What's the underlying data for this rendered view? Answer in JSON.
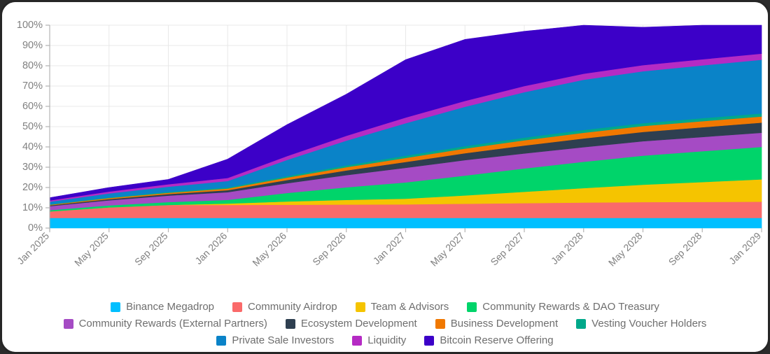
{
  "chart_data": {
    "type": "area",
    "stacked": true,
    "stack_mode": "percent",
    "title": "",
    "xlabel": "",
    "ylabel": "",
    "ylim": [
      0,
      100
    ],
    "ytick_labels": [
      "0%",
      "10%",
      "20%",
      "30%",
      "40%",
      "50%",
      "60%",
      "70%",
      "80%",
      "90%",
      "100%"
    ],
    "ytick_values": [
      0,
      10,
      20,
      30,
      40,
      50,
      60,
      70,
      80,
      90,
      100
    ],
    "grid": true,
    "legend_position": "bottom",
    "x": [
      "Jan 2025",
      "May 2025",
      "Sep 2025",
      "Jan 2026",
      "May 2026",
      "Sep 2026",
      "Jan 2027",
      "May 2027",
      "Sep 2027",
      "Jan 2028",
      "May 2028",
      "Sep 2028",
      "Jan 2029"
    ],
    "xtick_labels": [
      "Jan 2025",
      "May 2025",
      "Sep 2025",
      "Jan 2026",
      "May 2026",
      "Sep 2026",
      "Jan 2027",
      "May 2027",
      "Sep 2027",
      "Jan 2028",
      "May 2028",
      "Sep 2028",
      "Jan 2029"
    ],
    "series": [
      {
        "name": "Binance Megadrop",
        "color": "#00bfff",
        "values": [
          5.0,
          5.0,
          5.0,
          5.0,
          5.0,
          5.0,
          5.0,
          5.0,
          5.0,
          5.0,
          5.0,
          5.0,
          5.0
        ]
      },
      {
        "name": "Community Airdrop",
        "color": "#fa6a6a",
        "values": [
          3.2,
          5.2,
          6.4,
          6.4,
          6.5,
          6.6,
          6.7,
          7.0,
          7.3,
          7.6,
          7.8,
          7.9,
          8.0
        ]
      },
      {
        "name": "Team & Advisors",
        "color": "#f5c400",
        "values": [
          0.0,
          0.0,
          0.0,
          0.7,
          1.6,
          2.3,
          2.8,
          4.1,
          5.6,
          7.1,
          8.6,
          9.8,
          11.0
        ]
      },
      {
        "name": "Community Rewards & DAO Treasury",
        "color": "#00d46a",
        "values": [
          0.6,
          1.0,
          1.4,
          1.8,
          4.2,
          6.2,
          8.0,
          9.8,
          11.5,
          13.0,
          14.3,
          15.2,
          16.0
        ]
      },
      {
        "name": "Community Rewards (External Partners)",
        "color": "#a54bc4",
        "values": [
          2.0,
          2.5,
          3.2,
          3.8,
          4.8,
          6.0,
          7.2,
          7.6,
          7.4,
          7.2,
          7.1,
          7.0,
          7.0
        ]
      },
      {
        "name": "Ecosystem Development",
        "color": "#2e3f50",
        "values": [
          0.4,
          0.6,
          0.8,
          1.0,
          1.6,
          2.3,
          2.9,
          3.4,
          3.9,
          4.3,
          4.6,
          4.8,
          5.0
        ]
      },
      {
        "name": "Business Development",
        "color": "#f07800",
        "values": [
          0.3,
          0.5,
          0.6,
          0.8,
          1.2,
          1.6,
          2.0,
          2.3,
          2.6,
          2.8,
          2.9,
          3.0,
          3.0
        ]
      },
      {
        "name": "Vesting Voucher Holders",
        "color": "#00a88a",
        "values": [
          0.2,
          0.3,
          0.4,
          0.5,
          0.7,
          0.9,
          1.1,
          1.2,
          1.3,
          1.4,
          1.4,
          1.5,
          1.5
        ]
      },
      {
        "name": "Private Sale Investors",
        "color": "#0a83c8",
        "values": [
          1.3,
          2.0,
          2.6,
          3.2,
          8.0,
          12.2,
          16.0,
          19.4,
          22.4,
          24.7,
          25.6,
          26.0,
          26.5
        ]
      },
      {
        "name": "Liquidity",
        "color": "#b52bc4",
        "values": [
          0.6,
          0.9,
          1.2,
          1.5,
          1.9,
          2.4,
          2.8,
          2.9,
          3.0,
          3.0,
          3.0,
          3.0,
          3.0
        ]
      },
      {
        "name": "Bitcoin Reserve Offering",
        "color": "#3c00c8",
        "values": [
          1.4,
          2.0,
          2.4,
          9.3,
          15.5,
          20.5,
          28.5,
          30.3,
          27.0,
          23.9,
          18.7,
          16.8,
          14.0
        ]
      }
    ]
  },
  "legend": {
    "rows": [
      [
        {
          "label": "Binance Megadrop",
          "color": "#00bfff"
        },
        {
          "label": "Community Airdrop",
          "color": "#fa6a6a"
        },
        {
          "label": "Team & Advisors",
          "color": "#f5c400"
        },
        {
          "label": "Community Rewards & DAO Treasury",
          "color": "#00d46a"
        }
      ],
      [
        {
          "label": "Community Rewards (External Partners)",
          "color": "#a54bc4"
        },
        {
          "label": "Ecosystem Development",
          "color": "#2e3f50"
        },
        {
          "label": "Business Development",
          "color": "#f07800"
        },
        {
          "label": "Vesting Voucher Holders",
          "color": "#00a88a"
        }
      ],
      [
        {
          "label": "Private Sale Investors",
          "color": "#0a83c8"
        },
        {
          "label": "Liquidity",
          "color": "#b52bc4"
        },
        {
          "label": "Bitcoin Reserve Offering",
          "color": "#3c00c8"
        }
      ]
    ]
  }
}
